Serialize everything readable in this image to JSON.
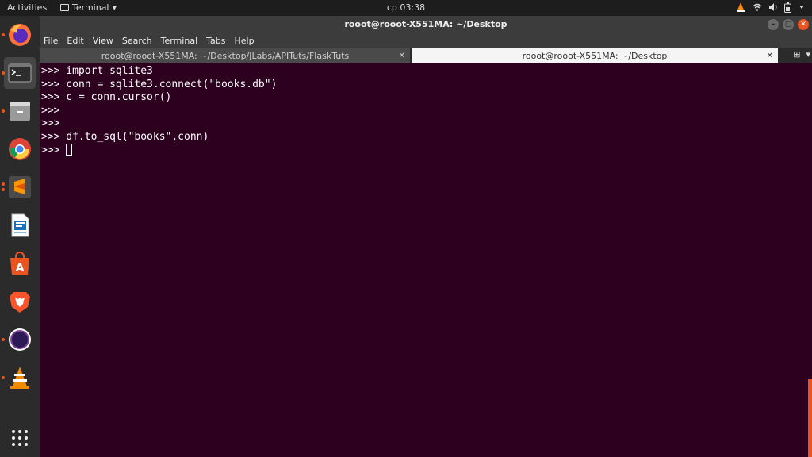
{
  "topbar": {
    "activities": "Activities",
    "app_name": "Terminal",
    "clock": "cp 03:38"
  },
  "dock": {
    "items": [
      {
        "name": "firefox"
      },
      {
        "name": "terminal"
      },
      {
        "name": "files"
      },
      {
        "name": "chrome"
      },
      {
        "name": "sublime-text"
      },
      {
        "name": "libreoffice-writer"
      },
      {
        "name": "ubuntu-software"
      },
      {
        "name": "brave"
      },
      {
        "name": "tor-browser"
      },
      {
        "name": "vlc"
      }
    ]
  },
  "window": {
    "title": "rooot@rooot-X551MA: ~/Desktop"
  },
  "menu": [
    "File",
    "Edit",
    "View",
    "Search",
    "Terminal",
    "Tabs",
    "Help"
  ],
  "tabs": [
    {
      "label": "rooot@rooot-X551MA: ~/Desktop/JLabs/APITuts/FlaskTuts",
      "active": false
    },
    {
      "label": "rooot@rooot-X551MA: ~/Desktop",
      "active": true
    }
  ],
  "terminal": {
    "lines": [
      ">>> import sqlite3",
      ">>> conn = sqlite3.connect(\"books.db\")",
      ">>> c = conn.cursor()",
      ">>>",
      ">>>",
      ">>> df.to_sql(\"books\",conn)",
      ">>> "
    ]
  },
  "colors": {
    "terminal_bg": "#2c001e",
    "accent": "#e95420"
  }
}
